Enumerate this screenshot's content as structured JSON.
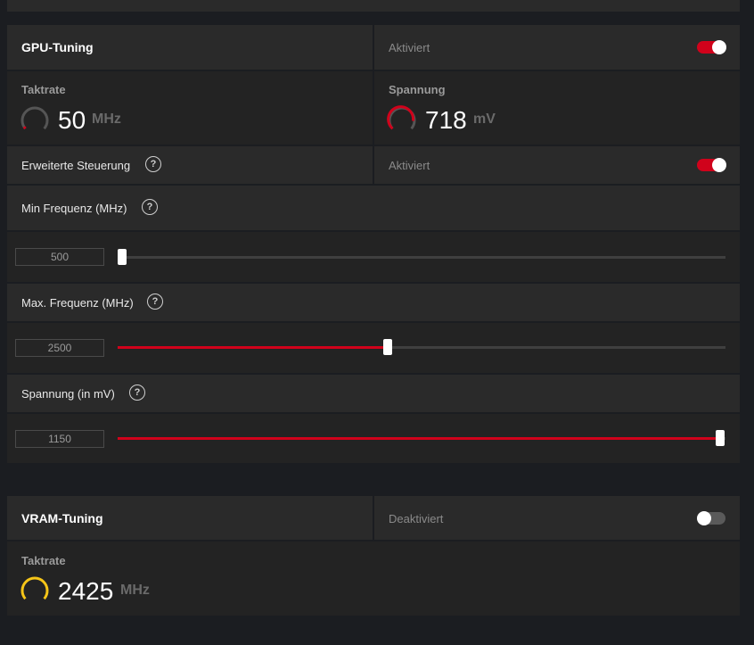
{
  "gpu_tuning": {
    "title": "GPU-Tuning",
    "status": "Aktiviert",
    "enabled": true,
    "clock": {
      "label": "Taktrate",
      "value": "50",
      "unit": "MHz"
    },
    "voltage": {
      "label": "Spannung",
      "value": "718",
      "unit": "mV"
    },
    "advanced": {
      "label": "Erweiterte Steuerung",
      "status": "Aktiviert",
      "enabled": true
    },
    "min_freq": {
      "label": "Min Frequenz (MHz)",
      "value": "500",
      "slider_fraction": 0.0
    },
    "max_freq": {
      "label": "Max. Frequenz (MHz)",
      "value": "2500",
      "slider_fraction": 0.44
    },
    "voltage_slider": {
      "label": "Spannung (in mV)",
      "value": "1150",
      "slider_fraction": 1.0
    }
  },
  "vram_tuning": {
    "title": "VRAM-Tuning",
    "status": "Deaktiviert",
    "enabled": false,
    "clock": {
      "label": "Taktrate",
      "value": "2425",
      "unit": "MHz"
    }
  },
  "icons": {
    "help": "help-icon",
    "gauge": "gauge-icon",
    "toggle": "toggle-switch"
  },
  "help_glyph": "?",
  "colors": {
    "accent": "#d0021b",
    "gauge_yellow": "#f5c518",
    "gauge_inactive": "#555555",
    "background": "#1b1d21",
    "panel": "#2a2a2a"
  }
}
